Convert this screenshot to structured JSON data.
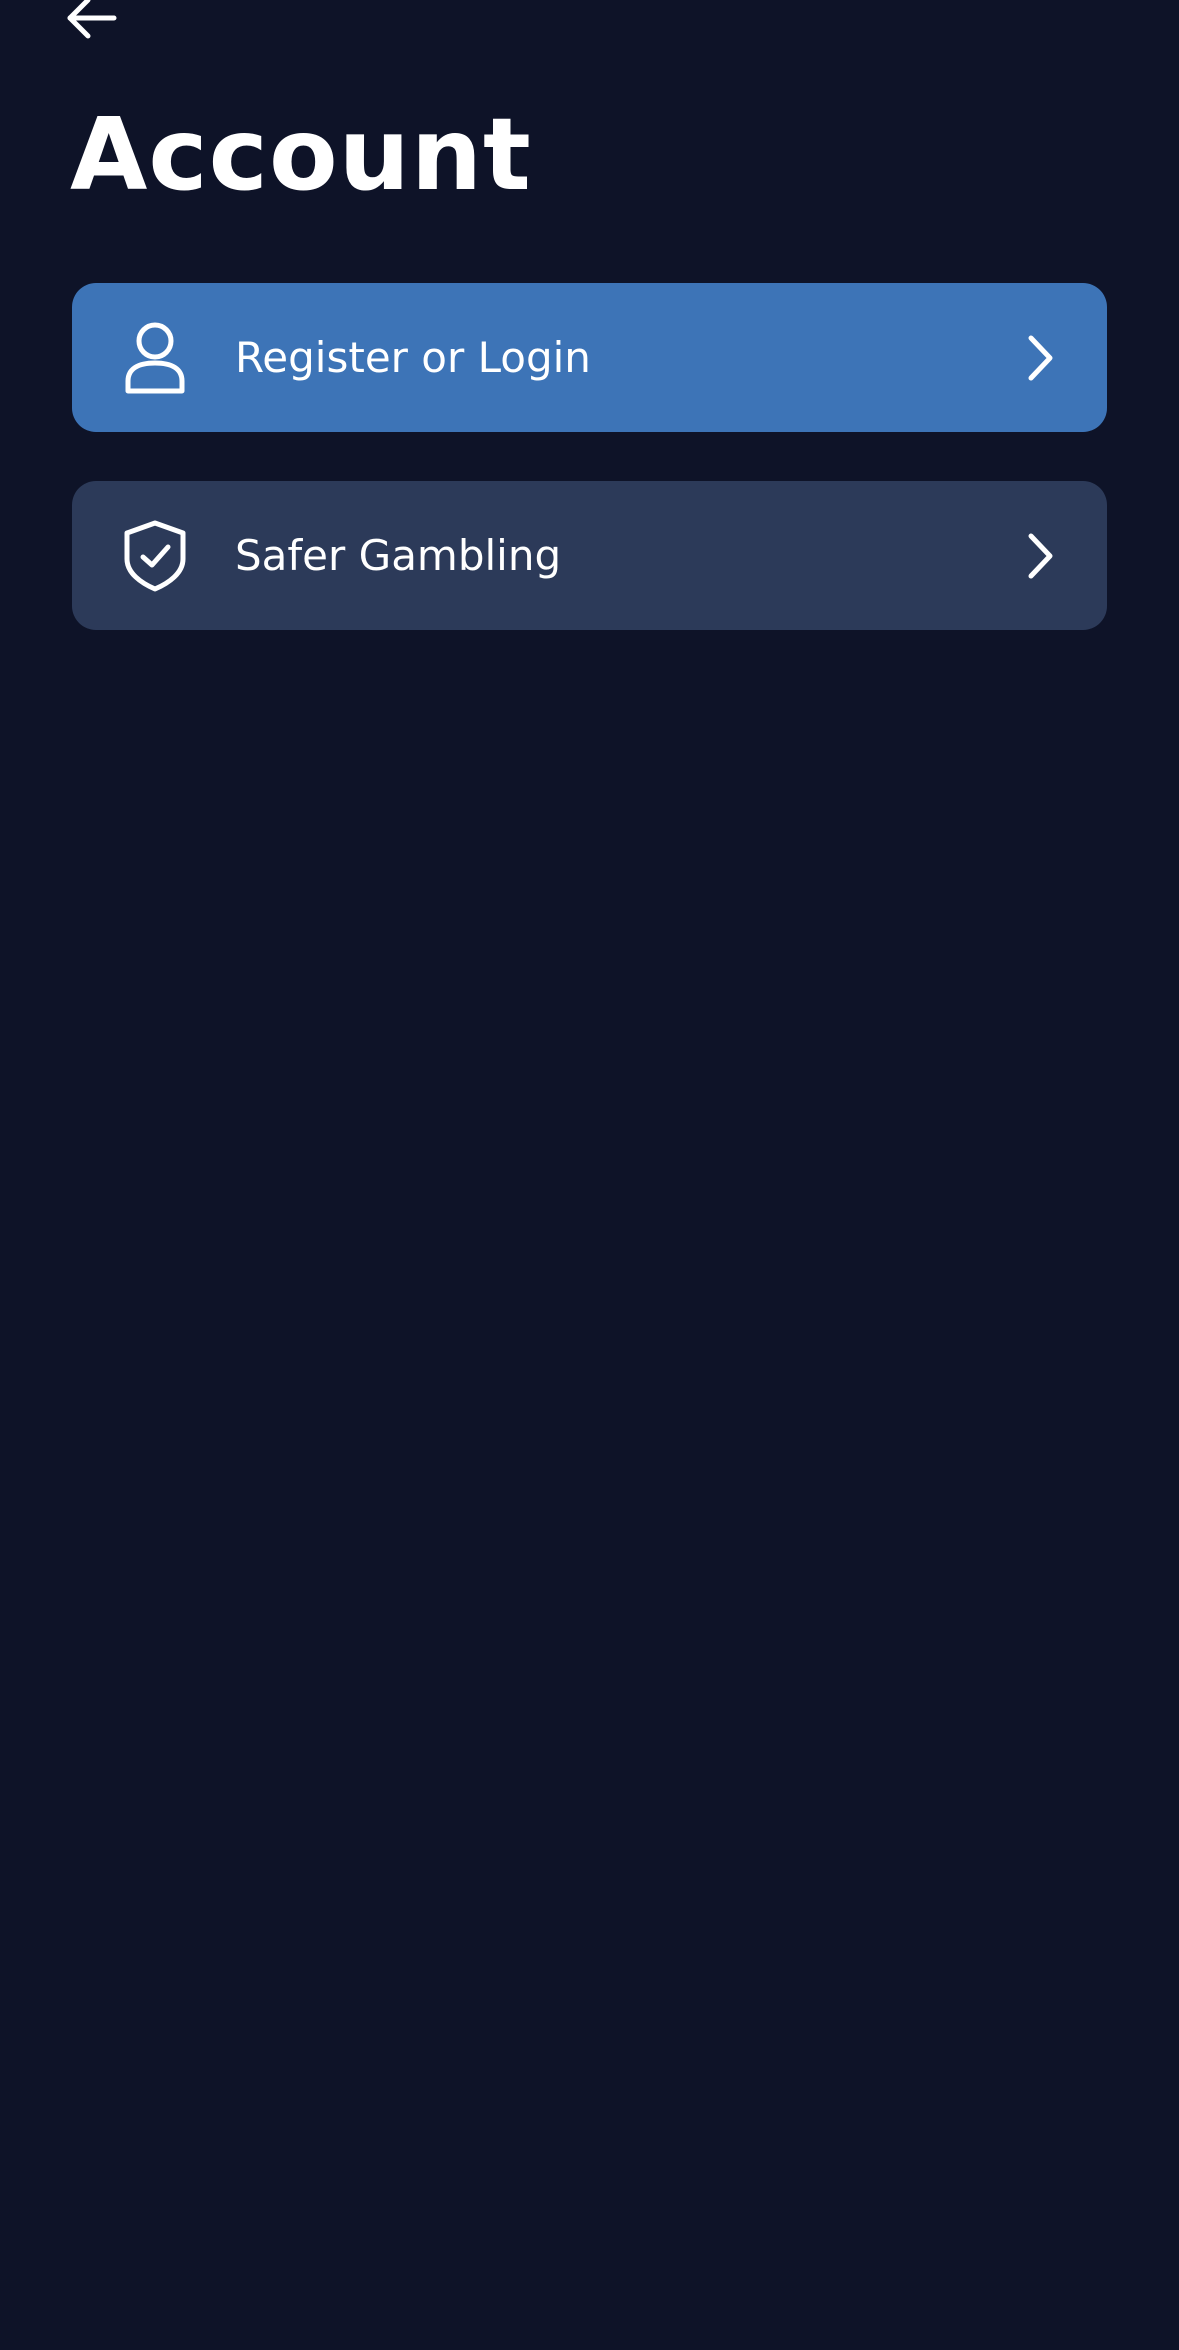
{
  "header": {
    "back_icon": "arrow-left-icon",
    "title": "Account"
  },
  "menu": {
    "items": [
      {
        "label": "Register or Login",
        "icon": "user-icon",
        "trailing_icon": "chevron-right-icon",
        "background": "#3d74b7"
      },
      {
        "label": "Safer Gambling",
        "icon": "shield-check-icon",
        "trailing_icon": "chevron-right-icon",
        "background": "#2c3a59"
      }
    ]
  },
  "theme": {
    "background": "#0e1328",
    "text": "#ffffff"
  }
}
